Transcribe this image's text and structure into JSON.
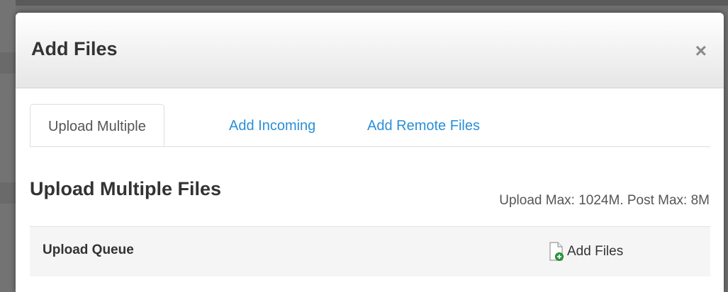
{
  "modal": {
    "title": "Add Files",
    "close_glyph": "×",
    "close_icon": "close-icon"
  },
  "tabs": [
    {
      "label": "Upload Multiple",
      "active": true
    },
    {
      "label": "Add Incoming",
      "active": false
    },
    {
      "label": "Add Remote Files",
      "active": false
    }
  ],
  "upload": {
    "section_title": "Upload Multiple Files",
    "limits_text": "Upload Max: 1024M. Post Max: 8M",
    "queue_label": "Upload Queue",
    "add_files_label": "Add Files",
    "add_files_icon": "file-add-icon"
  },
  "colors": {
    "link": "#2a8fd8",
    "text": "#333333",
    "add_badge": "#2e9e3a"
  }
}
